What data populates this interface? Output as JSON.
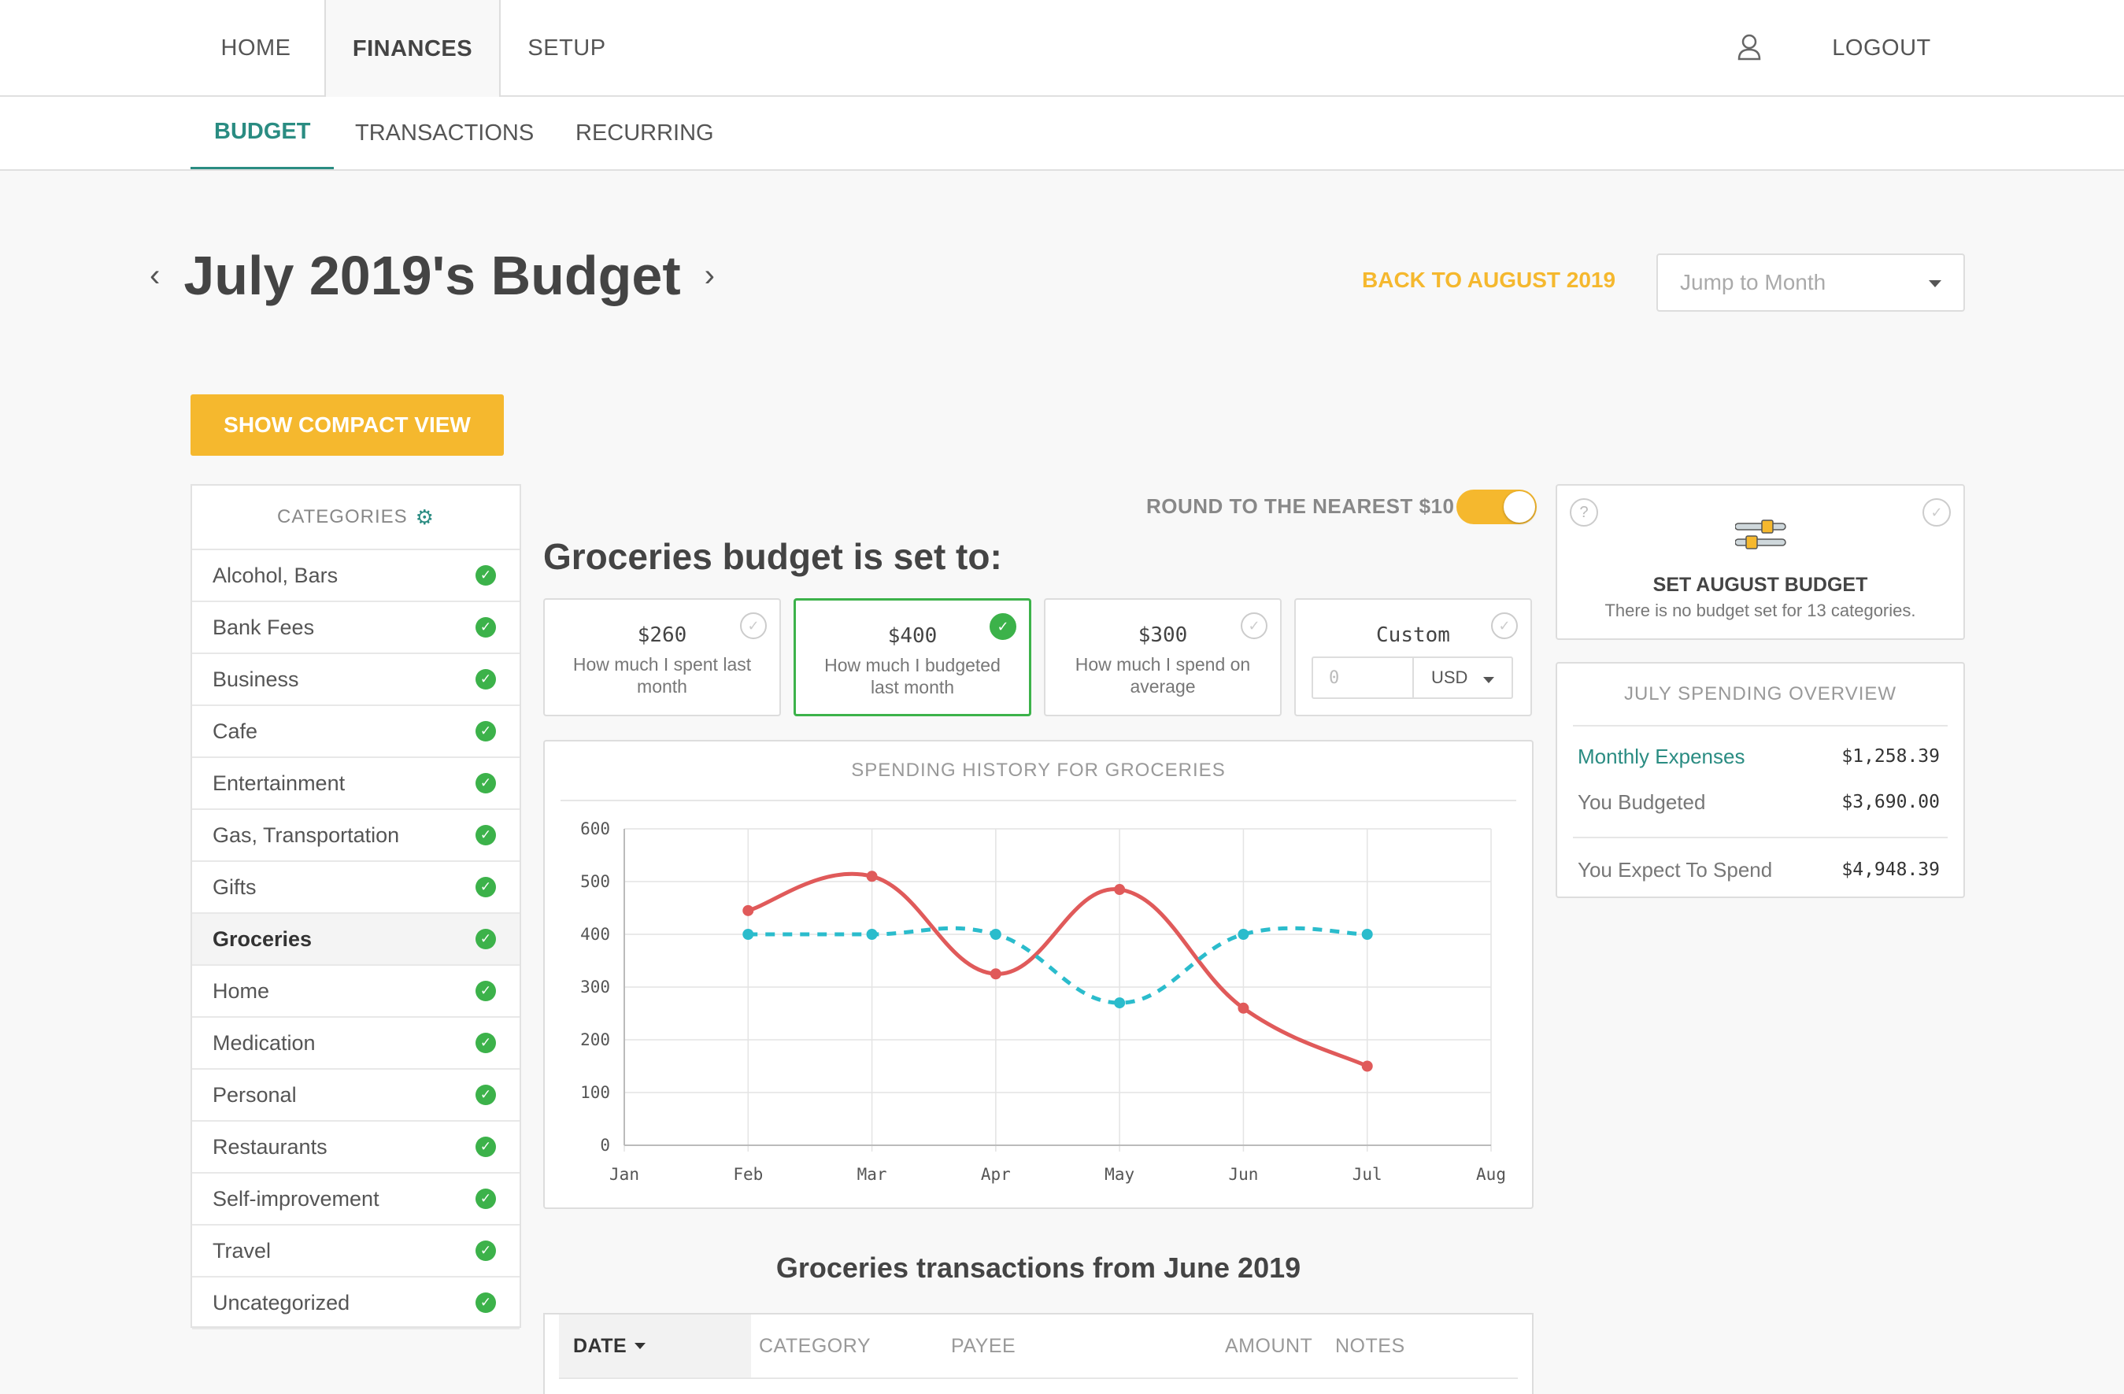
{
  "topnav": {
    "tabs": [
      {
        "label": "HOME"
      },
      {
        "label": "FINANCES"
      },
      {
        "label": "SETUP"
      }
    ],
    "logout": "LOGOUT"
  },
  "subnav": {
    "tabs": [
      {
        "label": "BUDGET"
      },
      {
        "label": "TRANSACTIONS"
      },
      {
        "label": "RECURRING"
      }
    ]
  },
  "header": {
    "title": "July 2019's Budget",
    "back_link": "BACK TO AUGUST 2019",
    "jump_placeholder": "Jump to Month"
  },
  "compact_button": "SHOW COMPACT VIEW",
  "categories": {
    "heading": "CATEGORIES",
    "items": [
      {
        "label": "Alcohol, Bars"
      },
      {
        "label": "Bank Fees"
      },
      {
        "label": "Business"
      },
      {
        "label": "Cafe"
      },
      {
        "label": "Entertainment"
      },
      {
        "label": "Gas, Transportation"
      },
      {
        "label": "Gifts"
      },
      {
        "label": "Groceries",
        "selected": true
      },
      {
        "label": "Home"
      },
      {
        "label": "Medication"
      },
      {
        "label": "Personal"
      },
      {
        "label": "Restaurants"
      },
      {
        "label": "Self-improvement"
      },
      {
        "label": "Travel"
      },
      {
        "label": "Uncategorized"
      }
    ]
  },
  "budget": {
    "round_label": "ROUND TO THE NEAREST $10",
    "round_on": true,
    "heading": "Groceries budget is set to:",
    "options": [
      {
        "amount": "$260",
        "desc": "How much I spent last month"
      },
      {
        "amount": "$400",
        "desc": "How much I budgeted last month",
        "selected": true
      },
      {
        "amount": "$300",
        "desc": "How much I spend on average"
      }
    ],
    "custom": {
      "label": "Custom",
      "placeholder": "0",
      "currency": "USD"
    }
  },
  "chart_title": "SPENDING HISTORY FOR GROCERIES",
  "chart_data": {
    "type": "line",
    "categories": [
      "Jan",
      "Feb",
      "Mar",
      "Apr",
      "May",
      "Jun",
      "Jul",
      "Aug"
    ],
    "ylim": [
      0,
      600
    ],
    "yticks": [
      0,
      100,
      200,
      300,
      400,
      500,
      600
    ],
    "series": [
      {
        "color": "#e05a5a",
        "style": "solid",
        "x": [
          "Feb",
          "Mar",
          "Apr",
          "May",
          "Jun",
          "Jul"
        ],
        "values": [
          445,
          510,
          325,
          485,
          260,
          150
        ]
      },
      {
        "color": "#2bbccc",
        "style": "dashed",
        "x": [
          "Feb",
          "Mar",
          "Apr",
          "May",
          "Jun",
          "Jul"
        ],
        "values": [
          400,
          400,
          400,
          270,
          400,
          400
        ]
      }
    ],
    "grid": true
  },
  "transactions": {
    "heading": "Groceries transactions from June 2019",
    "columns": [
      "DATE",
      "CATEGORY",
      "PAYEE",
      "AMOUNT",
      "NOTES"
    ]
  },
  "set_budget": {
    "title": "SET AUGUST BUDGET",
    "subtitle": "There is no budget set for 13 categories."
  },
  "overview": {
    "title": "JULY SPENDING OVERVIEW",
    "rows": [
      {
        "label": "Monthly Expenses",
        "value": "$1,258.39"
      },
      {
        "label": "You Budgeted",
        "value": "$3,690.00"
      },
      {
        "label": "You Expect To Spend",
        "value": "$4,948.39"
      }
    ]
  }
}
